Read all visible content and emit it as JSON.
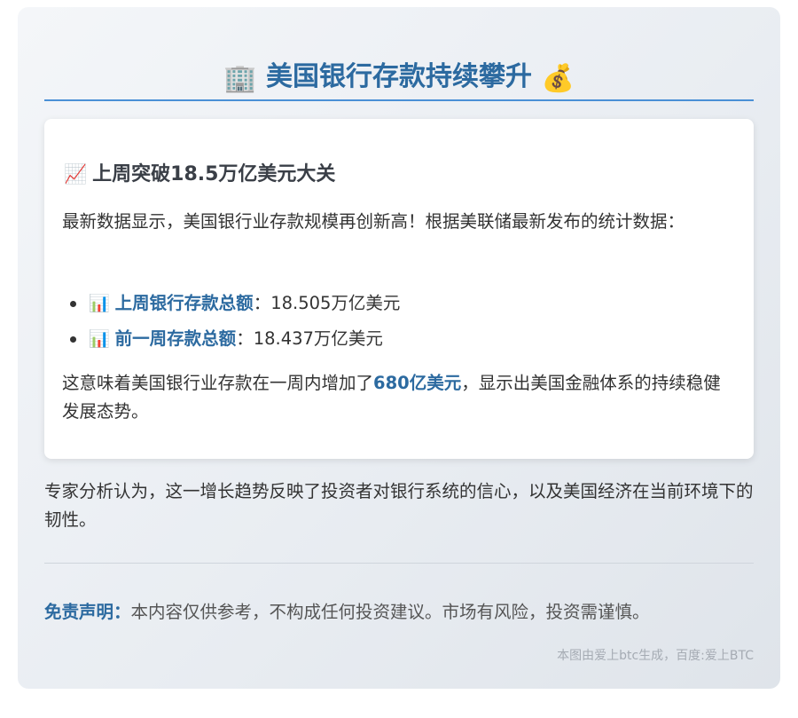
{
  "header": {
    "icon_left": "office-building-icon",
    "icon_left_glyph": "🏢",
    "title": "美国银行存款持续攀升",
    "icon_right": "money-bag-icon",
    "icon_right_glyph": "💰"
  },
  "section": {
    "icon": "chart-increasing-icon",
    "icon_glyph": "📈",
    "heading": "上周突破18.5万亿美元大关",
    "intro": "最新数据显示，美国银行业存款规模再创新高！根据美联储最新发布的统计数据：",
    "items": [
      {
        "icon": "bar-chart-icon",
        "icon_glyph": "📊",
        "label": "上周银行存款总额",
        "sep": "：",
        "value": "18.505万亿美元"
      },
      {
        "icon": "bar-chart-icon",
        "icon_glyph": "📊",
        "label": "前一周存款总额",
        "sep": "：",
        "value": "18.437万亿美元"
      }
    ],
    "summary_before": "这意味着美国银行业存款在一周内增加了",
    "summary_highlight": "680亿美元",
    "summary_after": "，显示出美国金融体系的持续稳健发展态势。"
  },
  "expert_text": "专家分析认为，这一增长趋势反映了投资者对银行系统的信心，以及美国经济在当前环境下的韧性。",
  "disclaimer": {
    "label": "免责声明：",
    "text": "本内容仅供参考，不构成任何投资建议。市场有风险，投资需谨慎。"
  },
  "footer": "本图由爱上btc生成，百度:爱上BTC",
  "colors": {
    "accent": "#2c6aa0",
    "rule": "#4a90d6",
    "text": "#333333",
    "muted": "#a5abb3"
  }
}
